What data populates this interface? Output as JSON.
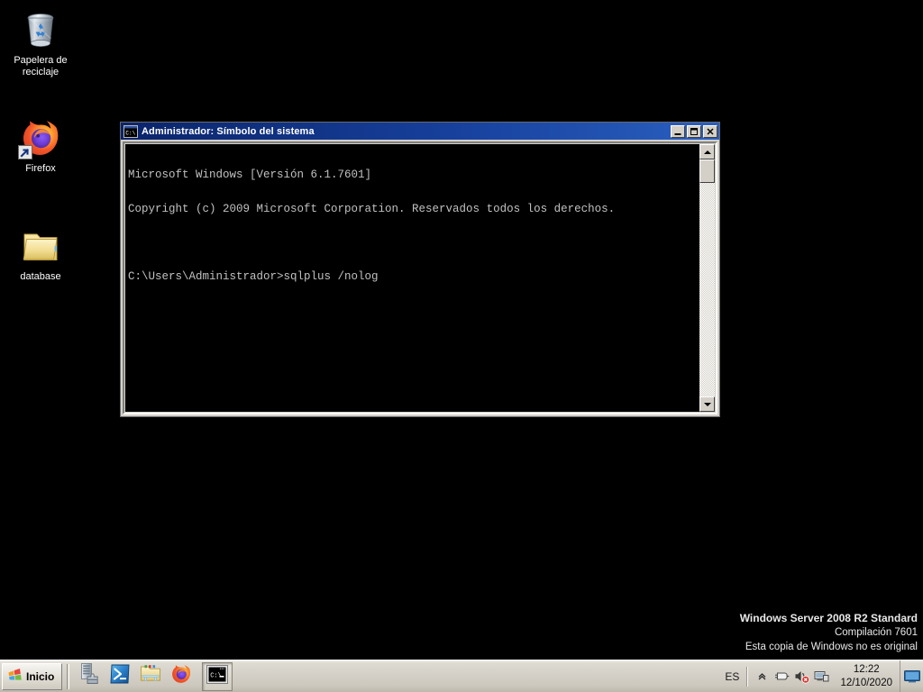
{
  "desktop": {
    "background_color": "#000000",
    "icons": [
      {
        "name": "recycle-bin",
        "label": "Papelera de\nreciclaje",
        "label_line1": "Papelera de",
        "label_line2": "reciclaje",
        "icon": "recycle-bin-icon"
      },
      {
        "name": "firefox",
        "label": "Firefox",
        "icon": "firefox-icon",
        "shortcut": true
      },
      {
        "name": "database",
        "label": "database",
        "icon": "folder-icon"
      }
    ]
  },
  "cmd_window": {
    "title": "Administrador: Símbolo del sistema",
    "title_icon": "console-icon",
    "buttons": {
      "minimize": "_",
      "maximize": "□",
      "close": "×"
    },
    "console_lines": [
      "Microsoft Windows [Versión 6.1.7601]",
      "Copyright (c) 2009 Microsoft Corporation. Reservados todos los derechos.",
      "",
      "C:\\Users\\Administrador>sqlplus /nolog"
    ],
    "text_color": "#c0c0c0",
    "background_color": "#000000",
    "titlebar_color": "#0a246a"
  },
  "watermark": {
    "title": "Windows Server 2008 R2 Standard",
    "build": "Compilación  7601",
    "notice": "Esta copia de Windows no es original"
  },
  "taskbar": {
    "start_label": "Inicio",
    "start_icon": "windows-flag-icon",
    "quick_launch": [
      {
        "name": "server-manager",
        "icon": "server-manager-icon"
      },
      {
        "name": "powershell",
        "icon": "powershell-icon"
      },
      {
        "name": "windows-explorer",
        "icon": "folder-explorer-icon"
      },
      {
        "name": "firefox",
        "icon": "firefox-icon"
      }
    ],
    "tasks": [
      {
        "name": "cmd",
        "icon": "console-icon",
        "active": true
      }
    ],
    "tray": {
      "language": "ES",
      "icons": [
        {
          "name": "show-hidden-icons",
          "icon": "chevron-up-icon"
        },
        {
          "name": "power",
          "icon": "power-plug-icon"
        },
        {
          "name": "volume",
          "icon": "speaker-muted-icon"
        },
        {
          "name": "network",
          "icon": "network-icon"
        }
      ],
      "clock_time": "12:22",
      "clock_date": "12/10/2020",
      "show_desktop": "show-desktop-icon"
    }
  }
}
